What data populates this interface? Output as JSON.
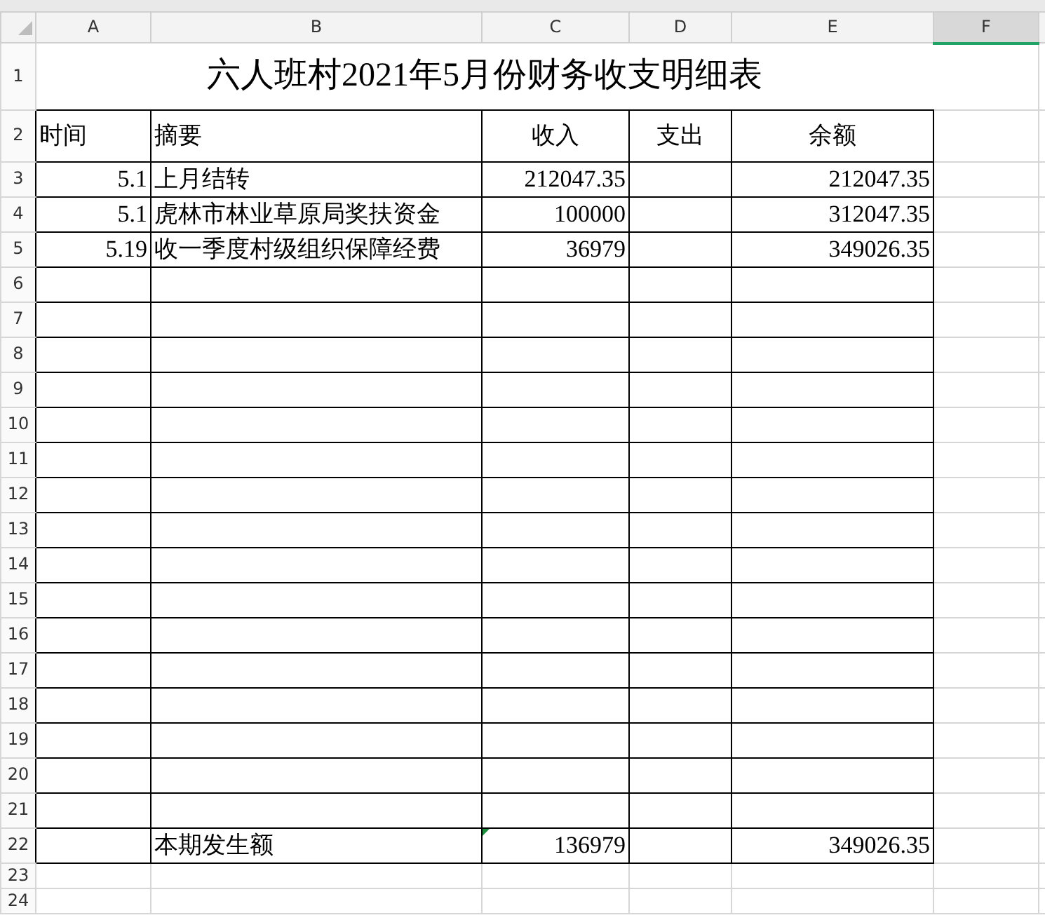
{
  "columns": [
    {
      "label": "A",
      "selected": false
    },
    {
      "label": "B",
      "selected": false
    },
    {
      "label": "C",
      "selected": false
    },
    {
      "label": "D",
      "selected": false
    },
    {
      "label": "E",
      "selected": false
    },
    {
      "label": "F",
      "selected": true
    }
  ],
  "rows": [
    {
      "number": "1",
      "kind": "title",
      "title": "六人班村2021年5月份财务收支明细表"
    },
    {
      "number": "2",
      "kind": "header",
      "a": "时间",
      "b": "摘要",
      "c": "收入",
      "d": "支出",
      "e": "余额"
    },
    {
      "number": "3",
      "kind": "data",
      "a": "5.1",
      "b": "上月结转",
      "c": "212047.35",
      "e": "212047.35"
    },
    {
      "number": "4",
      "kind": "data",
      "a": "5.1",
      "b": "虎林市林业草原局奖扶资金",
      "c": "100000",
      "e": "312047.35"
    },
    {
      "number": "5",
      "kind": "data",
      "a": "5.19",
      "b": "收一季度村级组织保障经费",
      "c": "36979",
      "e": "349026.35"
    },
    {
      "number": "6",
      "kind": "data"
    },
    {
      "number": "7",
      "kind": "data"
    },
    {
      "number": "8",
      "kind": "data"
    },
    {
      "number": "9",
      "kind": "data"
    },
    {
      "number": "10",
      "kind": "data"
    },
    {
      "number": "11",
      "kind": "data"
    },
    {
      "number": "12",
      "kind": "data"
    },
    {
      "number": "13",
      "kind": "data"
    },
    {
      "number": "14",
      "kind": "data"
    },
    {
      "number": "15",
      "kind": "data"
    },
    {
      "number": "16",
      "kind": "data"
    },
    {
      "number": "17",
      "kind": "data"
    },
    {
      "number": "18",
      "kind": "data"
    },
    {
      "number": "19",
      "kind": "data"
    },
    {
      "number": "20",
      "kind": "data"
    },
    {
      "number": "21",
      "kind": "data"
    },
    {
      "number": "22",
      "kind": "data",
      "b": "本期发生额",
      "c": "136979",
      "e": "349026.35",
      "c_marker": true
    },
    {
      "number": "23",
      "kind": "spacer"
    },
    {
      "number": "24",
      "kind": "spacer"
    }
  ]
}
